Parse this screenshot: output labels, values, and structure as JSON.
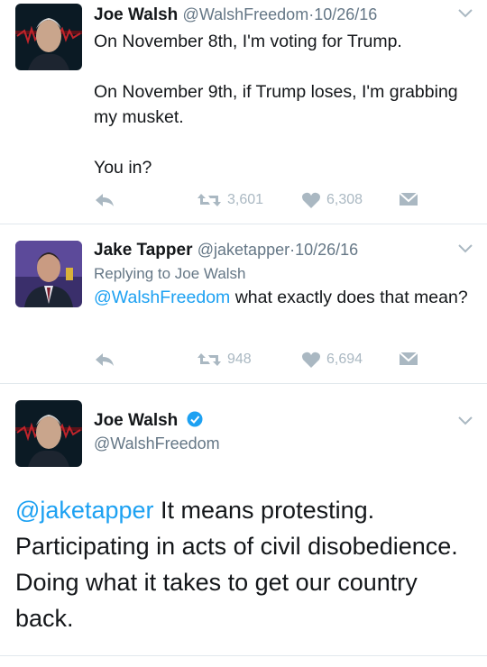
{
  "tweet1": {
    "name": "Joe Walsh",
    "handle": "@WalshFreedom",
    "dot": "·",
    "date": "10/26/16",
    "lines": [
      "On November 8th, I'm voting for Trump.",
      "On November 9th, if Trump loses, I'm grabbing my musket.",
      "You in?"
    ],
    "retweets": "3,601",
    "likes": "6,308"
  },
  "tweet2": {
    "name": "Jake Tapper",
    "handle": "@jaketapper",
    "dot": "·",
    "date": "10/26/16",
    "replying_to": "Replying to Joe Walsh",
    "mention": "@WalshFreedom",
    "text": " what exactly does that mean?",
    "retweets": "948",
    "likes": "6,694"
  },
  "tweet3": {
    "name": "Joe Walsh",
    "handle": "@WalshFreedom",
    "mention": "@jaketapper",
    "text": " It means protesting. Participating in acts of civil disobedience. Doing what it takes to get our country back."
  },
  "icons": {
    "reply": "reply-icon",
    "retweet": "retweet-icon",
    "like": "heart-icon",
    "dm": "envelope-icon",
    "more": "chevron-down-icon",
    "verified": "verified-badge-icon"
  },
  "colors": {
    "link": "#1da1f2",
    "secondary": "#657786",
    "action": "#aab8c2",
    "divider": "#e1e8ed"
  }
}
